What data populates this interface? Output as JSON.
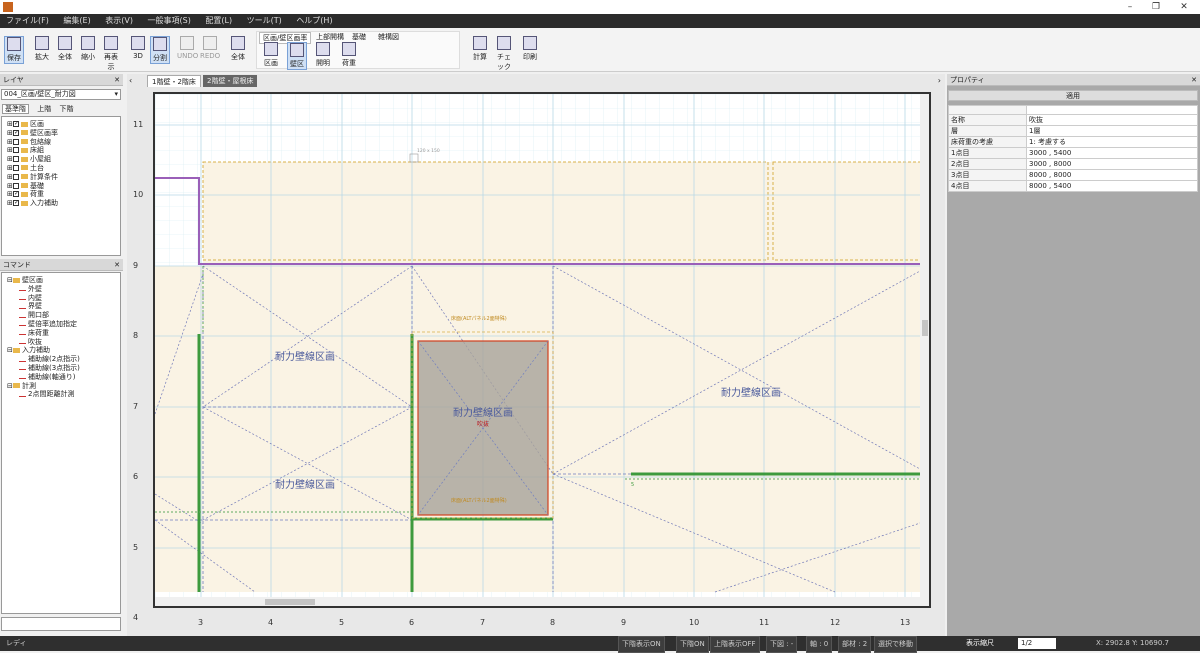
{
  "window": {
    "minimize": "–",
    "maximize": "❐",
    "close": "✕"
  },
  "menu": [
    "ファイル(F)",
    "編集(E)",
    "表示(V)",
    "一般事項(S)",
    "配置(L)",
    "ツール(T)",
    "ヘルプ(H)"
  ],
  "toolbar": {
    "save": "保存",
    "zoom_in": "拡大",
    "fit": "全体",
    "zoom_out": "縮小",
    "redraw": "再表示",
    "view3d": "3D",
    "split": "分割",
    "undo": "UNDO",
    "redo": "REDO",
    "overall": "全体",
    "group_tabs": [
      "区画/壁区画率",
      "上部開構",
      "基礎",
      "雑構図"
    ],
    "group_buttons": [
      "区画",
      "壁区",
      "開明",
      "荷重"
    ],
    "calc": "計算",
    "check": "チェック",
    "print": "印刷"
  },
  "layer_panel": {
    "title": "レイヤ",
    "dropdown": "004_区画/壁区_耐力図",
    "tabs": [
      "基準階",
      "上階",
      "下階"
    ],
    "items": [
      {
        "label": "区画",
        "checked": true
      },
      {
        "label": "壁区画率",
        "checked": true
      },
      {
        "label": "包絡線",
        "checked": false
      },
      {
        "label": "床組",
        "checked": false
      },
      {
        "label": "小屋組",
        "checked": false
      },
      {
        "label": "土台",
        "checked": false
      },
      {
        "label": "計算条件",
        "checked": false
      },
      {
        "label": "基礎",
        "checked": false
      },
      {
        "label": "荷重",
        "checked": true
      },
      {
        "label": "入力補助",
        "checked": true
      }
    ]
  },
  "command_panel": {
    "title": "コマンド",
    "tree": [
      {
        "label": "壁区画",
        "level": 0,
        "type": "folder"
      },
      {
        "label": "外壁",
        "level": 1,
        "type": "cmd"
      },
      {
        "label": "内壁",
        "level": 1,
        "type": "cmd"
      },
      {
        "label": "界壁",
        "level": 1,
        "type": "cmd"
      },
      {
        "label": "開口部",
        "level": 1,
        "type": "cmd"
      },
      {
        "label": "壁倍率追加指定",
        "level": 1,
        "type": "cmd"
      },
      {
        "label": "床荷重",
        "level": 1,
        "type": "cmd"
      },
      {
        "label": "吹抜",
        "level": 1,
        "type": "cmd"
      },
      {
        "label": "入力補助",
        "level": 0,
        "type": "folder"
      },
      {
        "label": "補助線(2点指示)",
        "level": 1,
        "type": "cmd"
      },
      {
        "label": "補助線(3点指示)",
        "level": 1,
        "type": "cmd"
      },
      {
        "label": "補助線(軸通り)",
        "level": 1,
        "type": "cmd"
      },
      {
        "label": "計測",
        "level": 0,
        "type": "folder"
      },
      {
        "label": "2点間距離計測",
        "level": 1,
        "type": "cmd"
      }
    ]
  },
  "doc_tabs": [
    "1階壁・2階床",
    "2階壁・屋根床"
  ],
  "drawing": {
    "y_axis": [
      "11",
      "10",
      "9",
      "8",
      "7",
      "6",
      "5",
      "4"
    ],
    "x_axis": [
      "3",
      "4",
      "5",
      "6",
      "7",
      "8",
      "9",
      "10",
      "11",
      "12",
      "13"
    ],
    "region_labels": [
      "耐力壁線区画",
      "耐力壁線区画",
      "耐力壁線区画",
      "耐力壁線区画"
    ],
    "sub_label": "吹抜",
    "annotation_top": "床面(ALTパネル2面特殊)",
    "annotation_bottom": "床面(ALTパネル2面特殊)",
    "small_labels": [
      "120 x 150",
      "5"
    ]
  },
  "property_panel": {
    "title": "プロパティ",
    "apply": "適用",
    "rows": [
      {
        "key": "名称",
        "value": "吹抜"
      },
      {
        "key": "層",
        "value": "1層"
      },
      {
        "key": "床荷重の考慮",
        "value": "1: 考慮する"
      },
      {
        "key": "1点目",
        "value": "3000 , 5400"
      },
      {
        "key": "2点目",
        "value": "3000 , 8000"
      },
      {
        "key": "3点目",
        "value": "8000 , 8000"
      },
      {
        "key": "4点目",
        "value": "8000 , 5400"
      }
    ]
  },
  "status": {
    "left": "レディ",
    "items": [
      "下階表示ON",
      "下階ON",
      "上階表示OFF",
      "下図 : -",
      "軸 : 0",
      "部材 : 2",
      "選択で移動",
      "表示縮尺"
    ],
    "page": "1/2",
    "coords": "X: 2902.8  Y: 10690.7"
  },
  "colors": {
    "accent": "#7aa1d6",
    "wall_green": "#3d9a3d",
    "region_purple": "#9a5fb8",
    "fill_beige": "#faf3e4",
    "hatch_gray": "#a8a39a",
    "selection_red": "#d04020"
  }
}
